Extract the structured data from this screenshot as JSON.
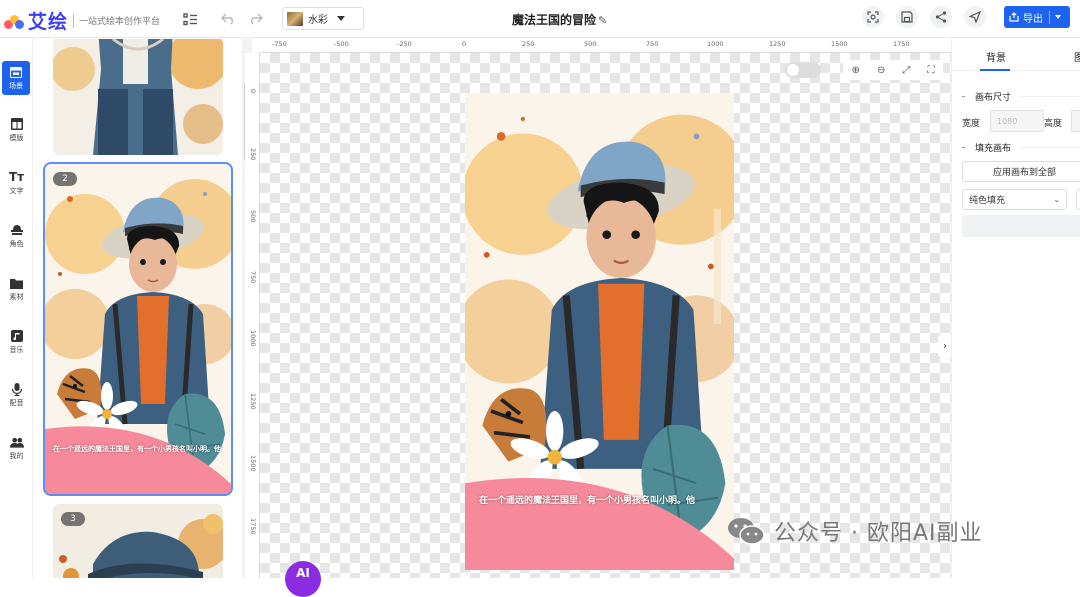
{
  "app": {
    "logo_text": "艾绘",
    "tagline": "一站式绘本创作平台",
    "doc_title": "魔法王国的冒险",
    "style_label": "水彩",
    "export_label": "导出"
  },
  "sidebar": {
    "items": [
      {
        "label": "场景",
        "icon": "scene-icon",
        "active": true
      },
      {
        "label": "模版",
        "icon": "template-icon"
      },
      {
        "label": "文字",
        "icon": "text-icon"
      },
      {
        "label": "角色",
        "icon": "character-icon"
      },
      {
        "label": "素材",
        "icon": "folder-icon"
      },
      {
        "label": "音乐",
        "icon": "music-icon"
      },
      {
        "label": "配音",
        "icon": "microphone-icon"
      },
      {
        "label": "我的",
        "icon": "user-group-icon"
      }
    ]
  },
  "scenes": [
    {
      "number": ""
    },
    {
      "number": "2",
      "caption": "在一个遥远的魔法王国里，有一个小男孩名叫小明。他"
    },
    {
      "number": "3"
    }
  ],
  "ruler": {
    "top": [
      "-750",
      "-500",
      "-250",
      "0",
      "250",
      "500",
      "750",
      "1000",
      "1250",
      "1500",
      "1750"
    ],
    "left": [
      "0",
      "250",
      "500",
      "750",
      "1000",
      "1250",
      "1500",
      "1750"
    ]
  },
  "canvas": {
    "caption": "在一个遥远的魔法王国里，有一个小男孩名叫小明。他"
  },
  "right_panel": {
    "tabs": [
      "背景",
      "图"
    ],
    "canvas_size_title": "画布尺寸",
    "width_label": "宽度",
    "width_value": "1080",
    "height_label": "高度",
    "fill_title": "填充画布",
    "apply_all_label": "应用画布到全部",
    "fill_type": "纯色填充"
  },
  "watermark": {
    "text": "公众号 · 欧阳AI副业"
  },
  "ai_badge": "AI",
  "colors": {
    "accent": "#1e62f0",
    "logo": "#3b3ff0",
    "scene_pink": "#f78a9a",
    "ai_purple": "#8b2be2"
  }
}
